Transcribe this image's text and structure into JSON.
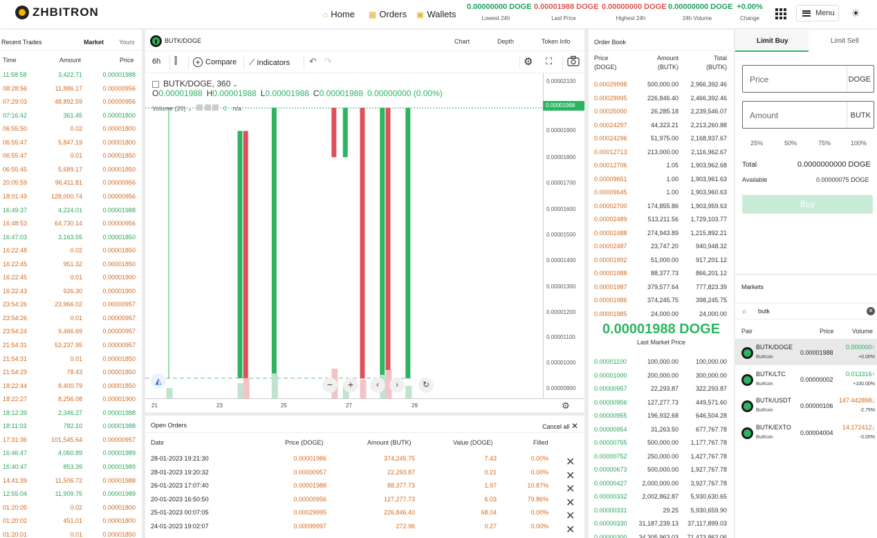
{
  "brand": {
    "name": "ZHBITRON"
  },
  "nav": {
    "home": "Home",
    "orders": "Orders",
    "wallets": "Wallets",
    "menu": "Menu"
  },
  "stats": [
    {
      "value": "0.00000000 DOGE",
      "label": "Lowest 24h"
    },
    {
      "value": "0.00001988 DOGE",
      "label": "Last Price"
    },
    {
      "value": "0.00000000 DOGE",
      "label": "Highest 24h"
    },
    {
      "value": "0.00000000 DOGE",
      "label": "24h Volume"
    },
    {
      "value": "+0.00%",
      "label": "Change"
    }
  ],
  "recent_trades": {
    "title": "Recent Trades",
    "tab_market": "Market",
    "tab_yours": "Yours",
    "col_time": "Time",
    "col_amount": "Amount",
    "col_price": "Price",
    "rows": [
      {
        "time": "11:58:58",
        "amount": "3,422.71",
        "price": "0.00001988",
        "side": "buy"
      },
      {
        "time": "08:28:56",
        "amount": "11,886.17",
        "price": "0.00000956",
        "side": "sell"
      },
      {
        "time": "07:29:03",
        "amount": "48,892.59",
        "price": "0.00000956",
        "side": "sell"
      },
      {
        "time": "07:16:42",
        "amount": "361.45",
        "price": "0.00001800",
        "side": "buy"
      },
      {
        "time": "06:55:50",
        "amount": "0.02",
        "price": "0.00001800",
        "side": "sell"
      },
      {
        "time": "06:55:47",
        "amount": "5,847.19",
        "price": "0.00001800",
        "side": "sell"
      },
      {
        "time": "06:55:47",
        "amount": "0.01",
        "price": "0.00001850",
        "side": "sell"
      },
      {
        "time": "06:55:45",
        "amount": "5,689.17",
        "price": "0.00001850",
        "side": "sell"
      },
      {
        "time": "20:05:59",
        "amount": "96,411.81",
        "price": "0.00000956",
        "side": "sell"
      },
      {
        "time": "18:01:49",
        "amount": "128,000.74",
        "price": "0.00000956",
        "side": "sell"
      },
      {
        "time": "16:49:37",
        "amount": "4,224.01",
        "price": "0.00001988",
        "side": "buy"
      },
      {
        "time": "16:48:53",
        "amount": "64,730.14",
        "price": "0.00000956",
        "side": "sell"
      },
      {
        "time": "16:47:03",
        "amount": "3,163.55",
        "price": "0.00001850",
        "side": "buy"
      },
      {
        "time": "16:22:48",
        "amount": "0.02",
        "price": "0.00001850",
        "side": "sell"
      },
      {
        "time": "16:22:45",
        "amount": "951.32",
        "price": "0.00001850",
        "side": "sell"
      },
      {
        "time": "16:22:45",
        "amount": "0.01",
        "price": "0.00001900",
        "side": "sell"
      },
      {
        "time": "16:22:43",
        "amount": "926.30",
        "price": "0.00001900",
        "side": "sell"
      },
      {
        "time": "23:54:26",
        "amount": "23,966.02",
        "price": "0.00000957",
        "side": "sell"
      },
      {
        "time": "23:54:26",
        "amount": "0.01",
        "price": "0.00000957",
        "side": "sell"
      },
      {
        "time": "23:54:24",
        "amount": "9,466.69",
        "price": "0.00000957",
        "side": "sell"
      },
      {
        "time": "21:54:31",
        "amount": "53,237.95",
        "price": "0.00000957",
        "side": "sell"
      },
      {
        "time": "21:54:31",
        "amount": "0.01",
        "price": "0.00001850",
        "side": "sell"
      },
      {
        "time": "21:54:29",
        "amount": "78.43",
        "price": "0.00001850",
        "side": "sell"
      },
      {
        "time": "18:22:44",
        "amount": "8,400.79",
        "price": "0.00001850",
        "side": "sell"
      },
      {
        "time": "18:22:27",
        "amount": "8,256.08",
        "price": "0.00001900",
        "side": "sell"
      },
      {
        "time": "18:12:39",
        "amount": "2,346.27",
        "price": "0.00001988",
        "side": "buy"
      },
      {
        "time": "18:11:03",
        "amount": "782.10",
        "price": "0.00001988",
        "side": "buy"
      },
      {
        "time": "17:31:36",
        "amount": "101,545.64",
        "price": "0.00000957",
        "side": "sell"
      },
      {
        "time": "16:46:47",
        "amount": "4,060.89",
        "price": "0.00001989",
        "side": "buy"
      },
      {
        "time": "16:40:47",
        "amount": "853.39",
        "price": "0.00001989",
        "side": "buy"
      },
      {
        "time": "14:41:39",
        "amount": "11,506.72",
        "price": "0.00001988",
        "side": "sell"
      },
      {
        "time": "12:55:04",
        "amount": "11,909.75",
        "price": "0.00001989",
        "side": "buy"
      },
      {
        "time": "01:20:05",
        "amount": "0.02",
        "price": "0.00001800",
        "side": "sell"
      },
      {
        "time": "01:20:02",
        "amount": "451.01",
        "price": "0.00001800",
        "side": "sell"
      },
      {
        "time": "01:20:01",
        "amount": "0.01",
        "price": "0.00001850",
        "side": "sell"
      }
    ]
  },
  "chart": {
    "pair": "BUTK/DOGE",
    "tab_chart": "Chart",
    "tab_depth": "Depth",
    "tab_token": "Token Info",
    "interval": "6h",
    "compare": "Compare",
    "indicators": "Indicators",
    "legend_symbol": "BUTK/DOGE, 360",
    "o_label": "O",
    "o": "0.00001988",
    "h_label": "H",
    "h": "0.00001988",
    "l_label": "L",
    "l": "0.00001988",
    "c_label": "C",
    "c": "0.00001988",
    "change": "0.00000000 (0.00%)",
    "volume_label": "Volume (20)",
    "volume_value": "0",
    "volume_na": "n/a",
    "y_ticks": [
      "0.00002100",
      "0.00001900",
      "0.00001800",
      "0.00001700",
      "0.00001600",
      "0.00001500",
      "0.00001400",
      "0.00001300",
      "0.00001200",
      "0.00001100",
      "0.00001000",
      "0.00000900"
    ],
    "price_label": "0.00001988",
    "x_ticks": [
      "21",
      "23",
      "25",
      "27",
      "29"
    ]
  },
  "chart_data": {
    "type": "candlestick",
    "pair": "BUTK/DOGE",
    "interval": "6h",
    "ylim": [
      8.8e-06,
      2.12e-05
    ],
    "candles": [
      {
        "t": 0.5,
        "o": 1.988e-05,
        "c": 1.988e-05,
        "h": 1.988e-05,
        "l": 9.57e-06
      },
      {
        "t": 3.0,
        "o": 9.57e-06,
        "c": 1.9e-05,
        "h": 1.9e-05,
        "l": 9.57e-06
      },
      {
        "t": 3.2,
        "o": 1.9e-05,
        "c": 9.57e-06,
        "h": 1.9e-05,
        "l": 9.57e-06
      },
      {
        "t": 4.2,
        "o": 9.57e-06,
        "c": 1.988e-05,
        "h": 1.988e-05,
        "l": 9.57e-06
      },
      {
        "t": 6.3,
        "o": 1.988e-05,
        "c": 1.8e-05,
        "h": 1.988e-05,
        "l": 1.8e-05
      },
      {
        "t": 6.7,
        "o": 1.8e-05,
        "c": 1.988e-05,
        "h": 1.988e-05,
        "l": 1.8e-05
      },
      {
        "t": 7.3,
        "o": 1.988e-05,
        "c": 9.56e-06,
        "h": 1.988e-05,
        "l": 9.56e-06
      },
      {
        "t": 8.0,
        "o": 9.56e-06,
        "c": 1.988e-05,
        "h": 1.988e-05,
        "l": 9.56e-06
      },
      {
        "t": 8.2,
        "o": 1.988e-05,
        "c": 9.56e-06,
        "h": 1.988e-05,
        "l": 9.56e-06
      },
      {
        "t": 8.9,
        "o": 9.56e-06,
        "c": 1.988e-05,
        "h": 1.988e-05,
        "l": 9.56e-06
      }
    ]
  },
  "open_orders": {
    "title": "Open Orders",
    "cancel_all": "Cancel all",
    "col_date": "Date",
    "col_price": "Price (DOGE)",
    "col_amount": "Amount (BUTK)",
    "col_value": "Value (DOGE)",
    "col_filled": "Filled",
    "rows": [
      {
        "date": "28-01-2023 19:21:30",
        "price": "0.00001986",
        "amount": "374,245.75",
        "value": "7.43",
        "filled": "0.00%"
      },
      {
        "date": "28-01-2023 19:20:32",
        "price": "0.00000957",
        "amount": "22,293.87",
        "value": "0.21",
        "filled": "0.00%"
      },
      {
        "date": "26-01-2023 17:07:40",
        "price": "0.00001988",
        "amount": "88,377.73",
        "value": "1.97",
        "filled": "10.87%"
      },
      {
        "date": "20-01-2023 16:50:50",
        "price": "0.00000956",
        "amount": "127,277.73",
        "value": "6.03",
        "filled": "79.86%"
      },
      {
        "date": "25-01-2023 00:07:05",
        "price": "0.00029995",
        "amount": "226,846.40",
        "value": "68.04",
        "filled": "0.00%"
      },
      {
        "date": "24-01-2023 19:02:07",
        "price": "0.00099997",
        "amount": "272.96",
        "value": "0.27",
        "filled": "0.00%"
      }
    ]
  },
  "order_book": {
    "title": "Order Book",
    "col_price": "Price",
    "col_price_unit": "(DOGE)",
    "col_amount": "Amount",
    "col_amount_unit": "(BUTK)",
    "col_total": "Total",
    "col_total_unit": "(BUTK)",
    "asks": [
      {
        "price": "0.00029998",
        "amount": "500,000.00",
        "total": "2,966,392.46"
      },
      {
        "price": "0.00029995",
        "amount": "226,846.40",
        "total": "2,466,392.46"
      },
      {
        "price": "0.00025000",
        "amount": "26,285.18",
        "total": "2,239,546.07"
      },
      {
        "price": "0.00024297",
        "amount": "44,323.21",
        "total": "2,213,260.88"
      },
      {
        "price": "0.00024296",
        "amount": "51,975.00",
        "total": "2,168,937.67"
      },
      {
        "price": "0.00012713",
        "amount": "213,000.00",
        "total": "2,116,962.67"
      },
      {
        "price": "0.00012706",
        "amount": "1.05",
        "total": "1,903,962.68"
      },
      {
        "price": "0.00009651",
        "amount": "1.00",
        "total": "1,903,961.63"
      },
      {
        "price": "0.00009645",
        "amount": "1.00",
        "total": "1,903,960.63"
      },
      {
        "price": "0.00002700",
        "amount": "174,855.86",
        "total": "1,903,959.63"
      },
      {
        "price": "0.00002489",
        "amount": "513,211.56",
        "total": "1,729,103.77"
      },
      {
        "price": "0.00002488",
        "amount": "274,943.89",
        "total": "1,215,892.21"
      },
      {
        "price": "0.00002487",
        "amount": "23,747.20",
        "total": "940,948.32"
      },
      {
        "price": "0.00001992",
        "amount": "51,000.00",
        "total": "917,201.12"
      },
      {
        "price": "0.00001988",
        "amount": "88,377.73",
        "total": "866,201.12"
      },
      {
        "price": "0.00001987",
        "amount": "379,577.64",
        "total": "777,823.39"
      },
      {
        "price": "0.00001986",
        "amount": "374,245.75",
        "total": "398,245.75"
      },
      {
        "price": "0.00001985",
        "amount": "24,000.00",
        "total": "24,000.00"
      }
    ],
    "last_price": "0.00001988 DOGE",
    "last_price_label": "Last Market Price",
    "bids": [
      {
        "price": "0.00001100",
        "amount": "100,000.00",
        "total": "100,000.00"
      },
      {
        "price": "0.00001000",
        "amount": "200,000.00",
        "total": "300,000.00"
      },
      {
        "price": "0.00000957",
        "amount": "22,293.87",
        "total": "322,293.87"
      },
      {
        "price": "0.00000956",
        "amount": "127,277.73",
        "total": "449,571.60"
      },
      {
        "price": "0.00000955",
        "amount": "196,932.68",
        "total": "646,504.28"
      },
      {
        "price": "0.00000954",
        "amount": "31,263.50",
        "total": "677,767.78"
      },
      {
        "price": "0.00000755",
        "amount": "500,000.00",
        "total": "1,177,767.78"
      },
      {
        "price": "0.00000752",
        "amount": "250,000.00",
        "total": "1,427,767.78"
      },
      {
        "price": "0.00000673",
        "amount": "500,000.00",
        "total": "1,927,767.78"
      },
      {
        "price": "0.00000427",
        "amount": "2,000,000.00",
        "total": "3,927,767.78"
      },
      {
        "price": "0.00000332",
        "amount": "2,002,862.87",
        "total": "5,930,630.65"
      },
      {
        "price": "0.00000331",
        "amount": "29.25",
        "total": "5,930,659.90"
      },
      {
        "price": "0.00000330",
        "amount": "31,187,239.13",
        "total": "37,117,899.03"
      },
      {
        "price": "0.00000300",
        "amount": "34,305,963.03",
        "total": "71,423,862.06"
      }
    ]
  },
  "trade_form": {
    "tab_buy": "Limit Buy",
    "tab_sell": "Limit Sell",
    "price_ph": "Price",
    "price_unit": "DOGE",
    "amount_ph": "Amount",
    "amount_unit": "BUTK",
    "pct": [
      "25%",
      "50%",
      "75%",
      "100%"
    ],
    "total_label": "Total",
    "total_value": "0.0000000000",
    "total_unit": "DOGE",
    "avail_label": "Available",
    "avail_value": "0.00000075",
    "avail_unit": "DOGE",
    "buy": "Buy"
  },
  "markets": {
    "title": "Markets",
    "search_value": "butk",
    "col_pair": "Pair",
    "col_price": "Price",
    "col_volume": "Volume",
    "rows": [
      {
        "pair": "BUTK/DOGE",
        "name": "ButKoin",
        "price": "0.00001988",
        "volume": "0.000000↑",
        "change": "+0.00%",
        "up": true
      },
      {
        "pair": "BUTK/LTC",
        "name": "ButKoin",
        "price": "0.00000002",
        "volume": "0.013316↑",
        "change": "+100.00%",
        "up": true
      },
      {
        "pair": "BUTK/USDT",
        "name": "ButKoin",
        "price": "0.00000106",
        "volume": "147.442898↓",
        "change": "-2.75%",
        "up": false
      },
      {
        "pair": "BUTK/EXTO",
        "name": "ButKoin",
        "price": "0.00004004",
        "volume": "14.172412↓",
        "change": "-0.05%",
        "up": false
      }
    ]
  },
  "colors": {
    "green": "#2bb560",
    "red": "#e0505a",
    "orange": "#d2691e"
  }
}
